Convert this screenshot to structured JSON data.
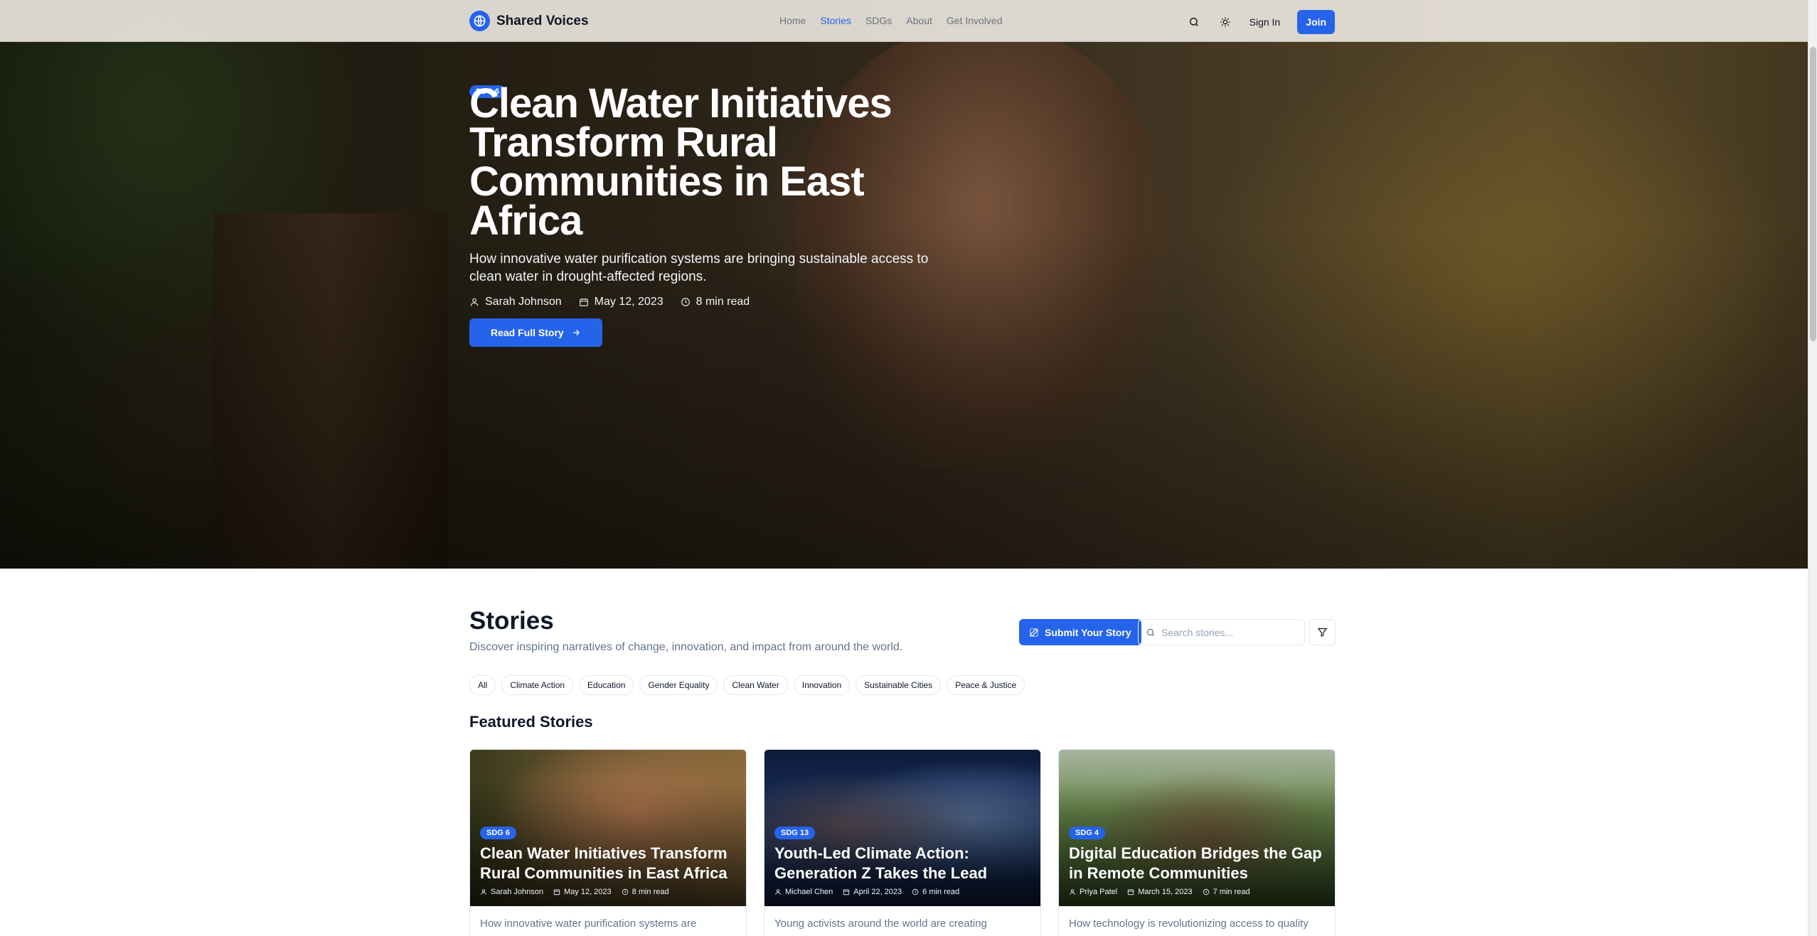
{
  "nav": {
    "brand": "Shared Voices",
    "links": [
      "Home",
      "Stories",
      "SDGs",
      "About",
      "Get Involved"
    ],
    "active_link": "Stories",
    "signin": "Sign In",
    "join": "Join"
  },
  "hero": {
    "badge": "SDG 6",
    "title": "Clean Water Initiatives Transform Rural Communities in East Africa",
    "subtitle": "How innovative water purification systems are bringing sustainable access to clean water in drought-affected regions.",
    "author": "Sarah Johnson",
    "date": "May 12, 2023",
    "read_time": "8 min read",
    "cta": "Read Full Story"
  },
  "stories": {
    "title": "Stories",
    "description": "Discover inspiring narratives of change, innovation, and impact from around the world.",
    "submit_label": "Submit Your Story",
    "search_placeholder": "Search stories...",
    "chips": [
      "All",
      "Climate Action",
      "Education",
      "Gender Equality",
      "Clean Water",
      "Innovation",
      "Sustainable Cities",
      "Peace & Justice"
    ],
    "featured_title": "Featured Stories",
    "cards": [
      {
        "badge": "SDG 6",
        "title": "Clean Water Initiatives Transform Rural Communities in East Africa",
        "author": "Sarah Johnson",
        "date": "May 12, 2023",
        "read_time": "8 min read",
        "excerpt": "How innovative water purification systems are"
      },
      {
        "badge": "SDG 13",
        "title": "Youth-Led Climate Action: Generation Z Takes the Lead",
        "author": "Michael Chen",
        "date": "April 22, 2023",
        "read_time": "6 min read",
        "excerpt": "Young activists around the world are creating"
      },
      {
        "badge": "SDG 4",
        "title": "Digital Education Bridges the Gap in Remote Communities",
        "author": "Priya Patel",
        "date": "March 15, 2023",
        "read_time": "7 min read",
        "excerpt": "How technology is revolutionizing access to quality"
      }
    ]
  },
  "colors": {
    "accent": "#2563eb",
    "text": "#0f172a",
    "muted": "#64748b"
  }
}
